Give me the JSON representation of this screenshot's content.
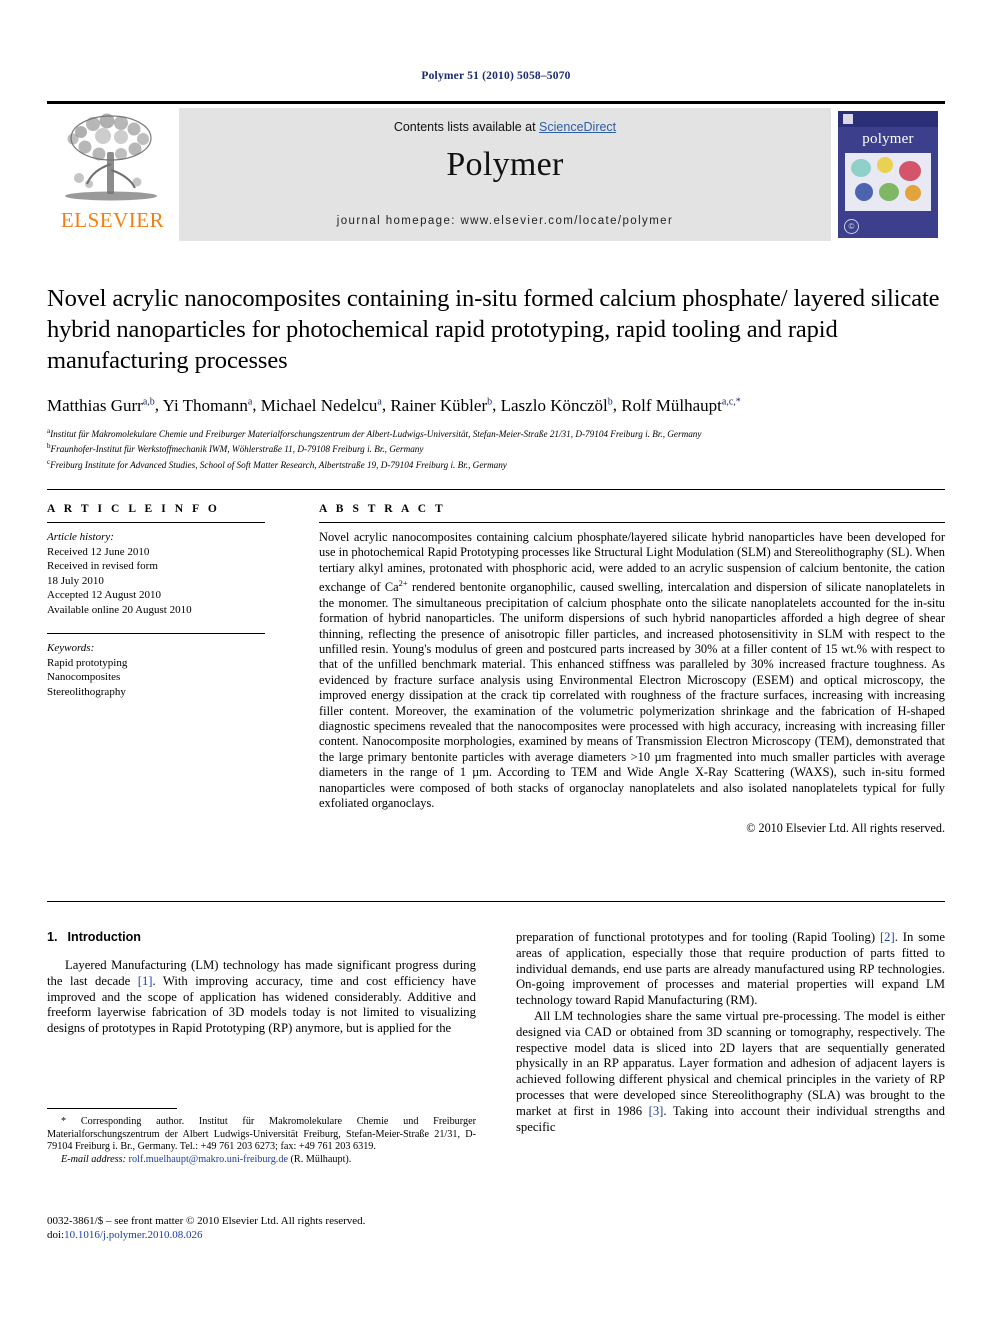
{
  "running_head": "Polymer 51 (2010) 5058–5070",
  "masthead": {
    "publisher_name": "ELSEVIER",
    "contents_prefix": "Contents lists available at ",
    "contents_link": "ScienceDirect",
    "journal_name": "Polymer",
    "homepage": "journal homepage: www.elsevier.com/locate/polymer",
    "cover_title": "polymer",
    "cover_badge": "©"
  },
  "article": {
    "title": "Novel acrylic nanocomposites containing in-situ formed calcium phosphate/ layered silicate hybrid nanoparticles for photochemical rapid prototyping, rapid tooling and rapid manufacturing processes",
    "authors": [
      {
        "name": "Matthias Gurr",
        "sup": "a,b",
        "sep": ", "
      },
      {
        "name": "Yi Thomann",
        "sup": "a",
        "sep": ", "
      },
      {
        "name": "Michael Nedelcu",
        "sup": "a",
        "sep": ", "
      },
      {
        "name": "Rainer Kübler",
        "sup": "b",
        "sep": ", "
      },
      {
        "name": "Laszlo Könczöl",
        "sup": "b",
        "sep": ", "
      },
      {
        "name": "Rolf Mülhaupt",
        "sup": "a,c,*",
        "sep": ""
      }
    ],
    "affiliations": [
      {
        "marker": "a",
        "text": "Institut für Makromolekulare Chemie und Freiburger Materialforschungszentrum der Albert-Ludwigs-Universität, Stefan-Meier-Straße 21/31, D-79104 Freiburg i. Br., Germany"
      },
      {
        "marker": "b",
        "text": "Fraunhofer-Institut für Werkstoffmechanik IWM, Wöhlerstraße 11, D-79108 Freiburg i. Br., Germany"
      },
      {
        "marker": "c",
        "text": "Freiburg Institute for Advanced Studies, School of Soft Matter Research, Albertstraße 19, D-79104 Freiburg i. Br., Germany"
      }
    ]
  },
  "article_info": {
    "heading": "A R T I C L E   I N F O",
    "history_label": "Article history:",
    "history_lines": [
      "Received 12 June 2010",
      "Received in revised form",
      "18 July 2010",
      "Accepted 12 August 2010",
      "Available online 20 August 2010"
    ],
    "keywords_label": "Keywords:",
    "keywords": [
      "Rapid prototyping",
      "Nanocomposites",
      "Stereolithography"
    ]
  },
  "abstract": {
    "heading": "A B S T R A C T",
    "part1": "Novel acrylic nanocomposites containing calcium phosphate/layered silicate hybrid nanoparticles have been developed for use in photochemical Rapid Prototyping processes like Structural Light Modulation (SLM) and Stereolithography (SL). When tertiary alkyl amines, protonated with phosphoric acid, were added to an acrylic suspension of calcium bentonite, the cation exchange of Ca",
    "superscript": "2+",
    "part2": " rendered bentonite organophilic, caused swelling, intercalation and dispersion of silicate nanoplatelets in the monomer. The simultaneous precipitation of calcium phosphate onto the silicate nanoplatelets accounted for the in-situ formation of hybrid nanoparticles. The uniform dispersions of such hybrid nanoparticles afforded a high degree of shear thinning, reflecting the presence of anisotropic filler particles, and increased photosensitivity in SLM with respect to the unfilled resin. Young's modulus of green and postcured parts increased by 30% at a filler content of 15 wt.% with respect to that of the unfilled benchmark material. This enhanced stiffness was paralleled by 30% increased fracture toughness. As evidenced by fracture surface analysis using Environmental Electron Microscopy (ESEM) and optical microscopy, the improved energy dissipation at the crack tip correlated with roughness of the fracture surfaces, increasing with increasing filler content. Moreover, the examination of the volumetric polymerization shrinkage and the fabrication of H-shaped diagnostic specimens revealed that the nanocomposites were processed with high accuracy, increasing with increasing filler content. Nanocomposite morphologies, examined by means of Transmission Electron Microscopy (TEM), demonstrated that the large primary bentonite particles with average diameters >10 µm fragmented into much smaller particles with average diameters in the range of 1 µm. According to TEM and Wide Angle X-Ray Scattering (WAXS), such in-situ formed nanoparticles were composed of both stacks of organoclay nanoplatelets and also isolated nanoplatelets typical for fully exfoliated organoclays.",
    "copyright": "© 2010 Elsevier Ltd. All rights reserved."
  },
  "introduction": {
    "number": "1.",
    "heading": "Introduction",
    "left_p1_a": "Layered Manufacturing (LM) technology has made significant progress during the last decade ",
    "left_p1_ref": "[1]",
    "left_p1_b": ". With improving accuracy, time and cost efficiency have improved and the scope of application has widened considerably. Additive and freeform layerwise fabrication of 3D models today is not limited to visualizing designs of prototypes in Rapid Prototyping (RP) anymore, but is applied for the",
    "right_p1_a": "preparation of functional prototypes and for tooling (Rapid Tooling) ",
    "right_p1_ref": "[2]",
    "right_p1_b": ". In some areas of application, especially those that require production of parts fitted to individual demands, end use parts are already manufactured using RP technologies. On-going improvement of processes and material properties will expand LM technology toward Rapid Manufacturing (RM).",
    "right_p2_a": "All LM technologies share the same virtual pre-processing. The model is either designed via CAD or obtained from 3D scanning or tomography, respectively. The respective model data is sliced into 2D layers that are sequentially generated physically in an RP apparatus. Layer formation and adhesion of adjacent layers is achieved following different physical and chemical principles in the variety of RP processes that were developed since Stereolithography (SLA) was brought to the market at first in 1986 ",
    "right_p2_ref": "[3]",
    "right_p2_b": ". Taking into account their individual strengths and specific"
  },
  "footnotes": {
    "corresponding": "* Corresponding author. Institut für Makromolekulare Chemie und Freiburger Materialforschungszentrum der Albert Ludwigs-Universität Freiburg, Stefan-Meier-Straße 21/31, D-79104 Freiburg i. Br., Germany. Tel.: +49 761 203 6273; fax: +49 761 203 6319.",
    "email_label": "E-mail address:",
    "email": "rolf.muelhaupt@makro.uni-freiburg.de",
    "email_owner": "(R. Mülhaupt).",
    "issn_line": "0032-3861/$ – see front matter © 2010 Elsevier Ltd. All rights reserved.",
    "doi_label": "doi:",
    "doi": "10.1016/j.polymer.2010.08.026"
  },
  "colors": {
    "link": "#1b3fa0",
    "elsevier_orange": "#F07F13",
    "masthead_grey": "#e3e3e3",
    "running_head": "#1b2a6b"
  }
}
